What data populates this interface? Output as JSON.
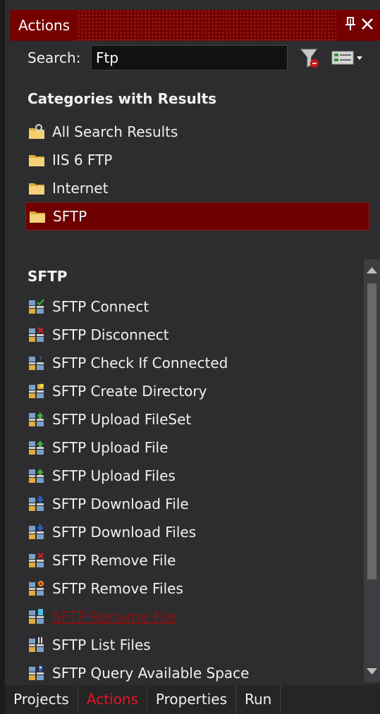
{
  "window": {
    "title": "Actions",
    "pin_glyph": "🖈",
    "close_glyph": "✕"
  },
  "search": {
    "label": "Search:",
    "value": "Ftp",
    "placeholder": ""
  },
  "categories": {
    "title": "Categories with Results",
    "items": [
      {
        "label": "All Search Results",
        "icon": "search-folder-icon"
      },
      {
        "label": "IIS 6 FTP",
        "icon": "folder-icon"
      },
      {
        "label": "Internet",
        "icon": "folder-icon"
      },
      {
        "label": "SFTP",
        "icon": "folder-icon",
        "selected": true
      }
    ]
  },
  "actions": {
    "title": "SFTP",
    "items": [
      {
        "label": "SFTP Connect",
        "icon": "sftp-connect-icon"
      },
      {
        "label": "SFTP Disconnect",
        "icon": "sftp-disconnect-icon"
      },
      {
        "label": "SFTP Check If Connected",
        "icon": "sftp-check-icon"
      },
      {
        "label": "SFTP Create Directory",
        "icon": "sftp-create-directory-icon"
      },
      {
        "label": "SFTP Upload FileSet",
        "icon": "sftp-upload-icon"
      },
      {
        "label": "SFTP Upload File",
        "icon": "sftp-upload-icon"
      },
      {
        "label": "SFTP Upload Files",
        "icon": "sftp-upload-icon"
      },
      {
        "label": "SFTP Download File",
        "icon": "sftp-download-icon"
      },
      {
        "label": "SFTP Download Files",
        "icon": "sftp-download-icon"
      },
      {
        "label": "SFTP Remove File",
        "icon": "sftp-remove-icon"
      },
      {
        "label": "SFTP Remove Files",
        "icon": "sftp-remove-icon"
      },
      {
        "label": "SFTP Rename File",
        "icon": "sftp-rename-icon",
        "hovered_link": true
      },
      {
        "label": "SFTP List Files",
        "icon": "sftp-list-icon"
      },
      {
        "label": "SFTP Query Available Space",
        "icon": "sftp-query-icon"
      }
    ]
  },
  "tabs": [
    {
      "label": "Projects"
    },
    {
      "label": "Actions",
      "active": true
    },
    {
      "label": "Properties"
    },
    {
      "label": "Run"
    }
  ],
  "colors": {
    "accent": "#750000",
    "selected": "#6e0000",
    "active_tab": "#e81123",
    "background": "#2d2d30"
  }
}
